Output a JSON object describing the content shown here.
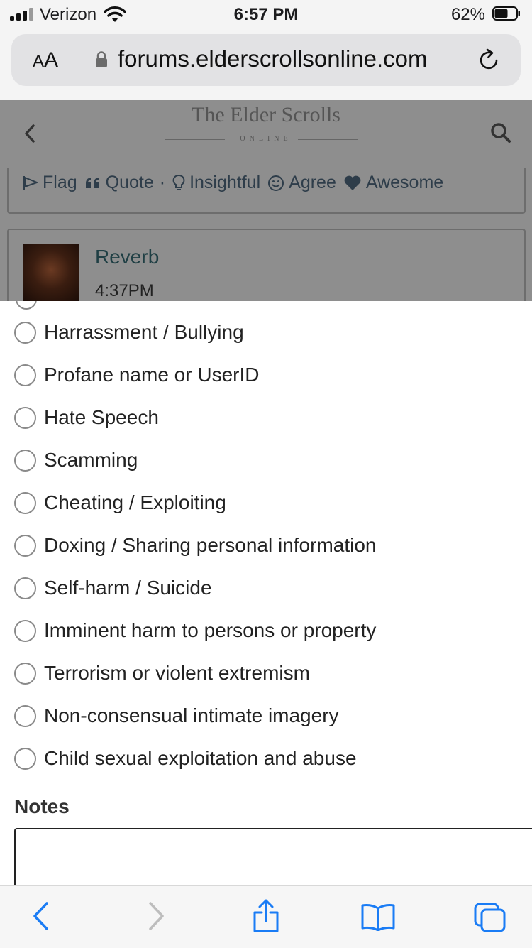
{
  "status_bar": {
    "carrier": "Verizon",
    "time": "6:57 PM",
    "battery": "62%",
    "battery_level": 0.62
  },
  "url_bar": {
    "aa_small": "A",
    "aa_large": "A",
    "domain": "forums.elderscrollsonline.com"
  },
  "site_header": {
    "logo_title": "The Elder Scrolls",
    "logo_subtitle": "ONLINE"
  },
  "post_actions": {
    "flag": "Flag",
    "quote": "Quote",
    "separator": "·",
    "insightful": "Insightful",
    "agree": "Agree",
    "awesome": "Awesome"
  },
  "post": {
    "author": "Reverb",
    "time": "4:37PM"
  },
  "report": {
    "reasons": [
      "Harrassment / Bullying",
      "Profane name or UserID",
      "Hate Speech",
      "Scamming",
      "Cheating / Exploiting",
      "Doxing / Sharing personal information",
      "Self-harm / Suicide",
      "Imminent harm to persons or property",
      "Terrorism or violent extremism",
      "Non-consensual intimate imagery",
      "Child sexual exploitation and abuse"
    ],
    "notes_label": "Notes",
    "notes_value": ""
  },
  "colors": {
    "accent": "#1a7cf5",
    "disabled": "#bdbdbd",
    "dim_overlay": "#8e8e8e"
  },
  "icons": {
    "toolbar": [
      "back-arrow-icon",
      "forward-arrow-icon",
      "share-icon",
      "bookmarks-icon",
      "tabs-icon"
    ]
  }
}
